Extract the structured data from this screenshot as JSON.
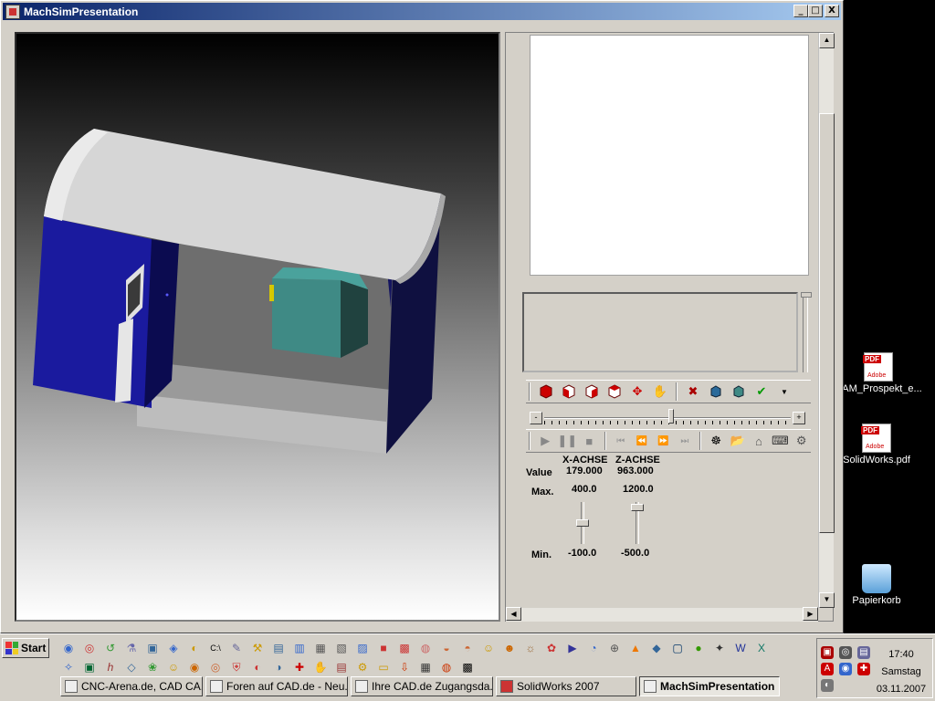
{
  "window": {
    "title": "MachSimPresentation",
    "buttons": {
      "minimize": "_",
      "maximize": "□",
      "close": "X"
    }
  },
  "controls": {
    "headers": {
      "x": "X-ACHSE",
      "z": "Z-ACHSE"
    },
    "row_labels": {
      "value": "Value",
      "max": "Max.",
      "min": "Min."
    },
    "x": {
      "value": "179.000",
      "max": "400.0",
      "min": "-100.0"
    },
    "z": {
      "value": "963.000",
      "max": "1200.0",
      "min": "-500.0"
    }
  },
  "toolbar_view_icons": [
    "red-cube-icon",
    "cube-front-icon",
    "cube-side-icon",
    "cube-top-icon",
    "pan-icon",
    "rotate-icon",
    "collision-icon",
    "layers-icon",
    "stock-icon",
    "verify-icon",
    "dropdown-arrow-icon"
  ],
  "toolbar_playback_icons": [
    "play-icon",
    "pause-icon",
    "stop-icon",
    "skip-start-icon",
    "step-back-icon",
    "step-forward-icon",
    "skip-end-icon",
    "wheel-icon",
    "open-folder-icon",
    "machine-icon",
    "keyboard-icon",
    "settings-icon"
  ],
  "desktop_icons": [
    {
      "label": "CAM_Prospekt_e...",
      "icon": "pdf-icon"
    },
    {
      "label": "SolidWorks.pdf",
      "icon": "pdf-icon"
    },
    {
      "label": "Papierkorb",
      "icon": "recycle-bin-icon"
    }
  ],
  "taskbar": {
    "start_label": "Start",
    "tasks": [
      {
        "label": "CNC-Arena.de, CAD CA..."
      },
      {
        "label": "Foren auf CAD.de - Neu..."
      },
      {
        "label": "Ihre CAD.de Zugangsda..."
      },
      {
        "label": "SolidWorks 2007"
      },
      {
        "label": "MachSimPresentation"
      }
    ],
    "clock": {
      "time": "17:40",
      "day": "Samstag",
      "date": "03.11.2007"
    }
  },
  "colors": {
    "titlebar_start": "#0a246a",
    "machine_blue": "#1a1a9e",
    "machine_roof": "#d6d6d6",
    "spindle_teal": "#3f8a85"
  }
}
